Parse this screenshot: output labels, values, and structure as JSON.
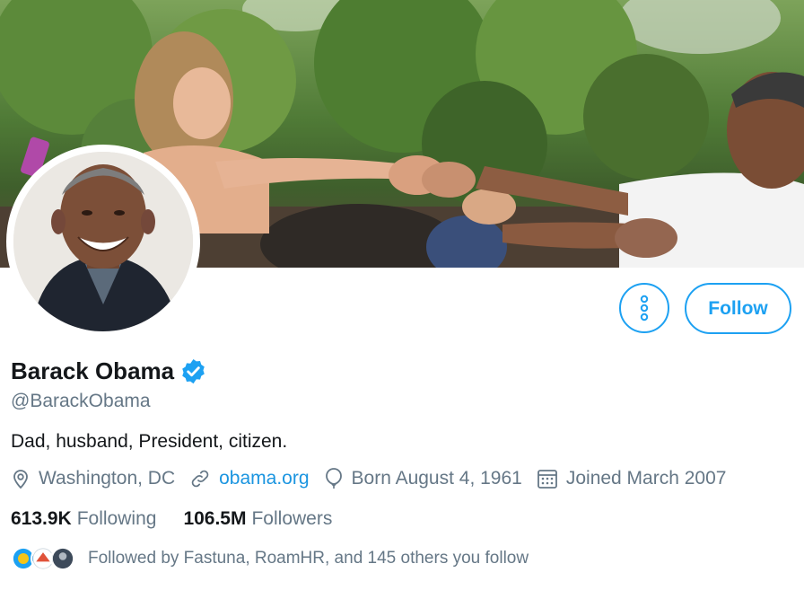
{
  "profile": {
    "name": "Barack Obama",
    "handle": "@BarackObama",
    "bio": "Dad, husband, President, citizen.",
    "verified": true
  },
  "meta": {
    "location": "Washington, DC",
    "website": "obama.org",
    "birthday": "Born August 4, 1961",
    "joined": "Joined March 2007"
  },
  "stats": {
    "following_count": "613.9K",
    "following_label": "Following",
    "followers_count": "106.5M",
    "followers_label": "Followers"
  },
  "followed_by": "Followed by Fastuna, RoamHR, and 145 others you follow",
  "actions": {
    "follow_label": "Follow"
  },
  "icons": [
    "location-icon",
    "link-icon",
    "balloon-icon",
    "calendar-icon",
    "more-options-icon",
    "verified-badge-icon"
  ],
  "colors": {
    "accent": "#1da1f2",
    "link": "#1b95e0",
    "secondary_text": "#657786",
    "primary_text": "#14171a"
  }
}
